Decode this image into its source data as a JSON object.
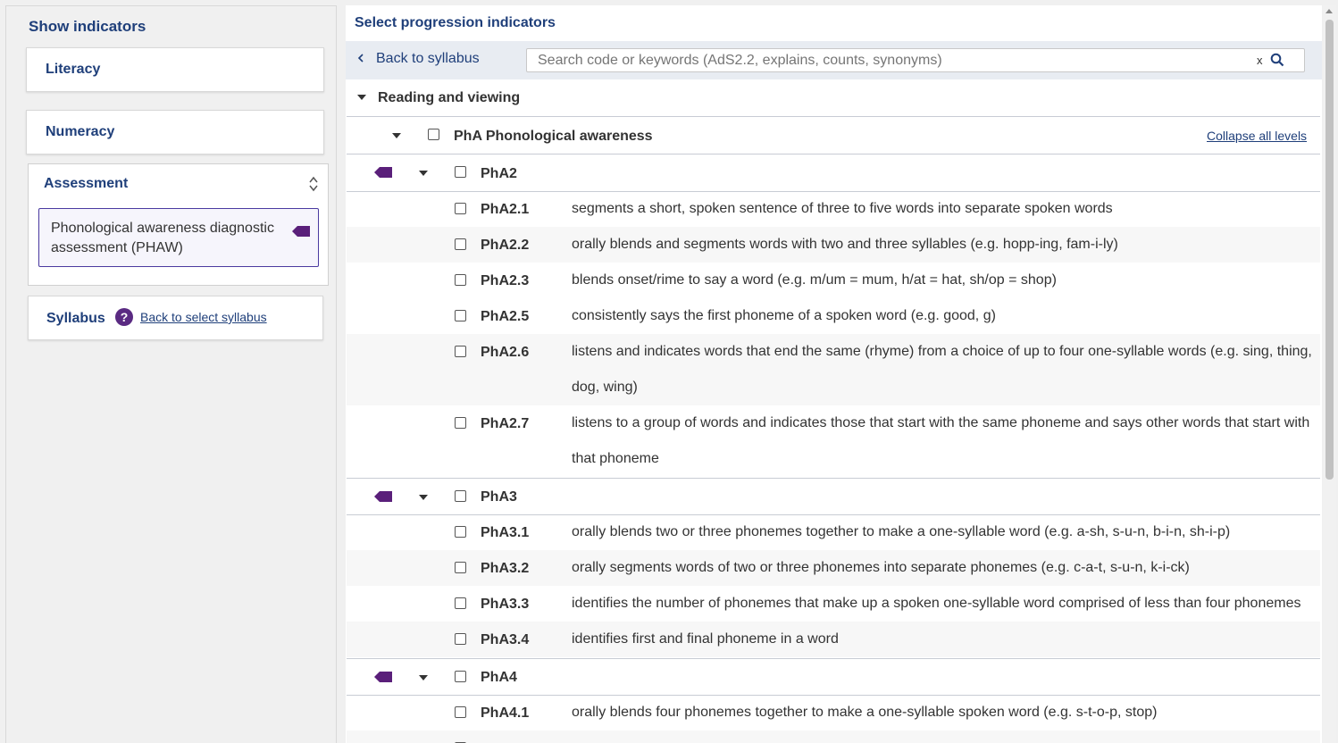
{
  "left": {
    "title": "Show indicators",
    "literacy": "Literacy",
    "numeracy": "Numeracy",
    "assessment": "Assessment",
    "assessment_item": "Phonological awareness diagnostic assessment (PHAW)",
    "syllabus": "Syllabus",
    "help": "?",
    "back_to_select_syllabus": "Back to select syllabus"
  },
  "right": {
    "title": "Select progression indicators",
    "back_to_syllabus": "Back to syllabus",
    "search_placeholder": "Search code or keywords (AdS2.2, explains, counts, synonyms)",
    "search_clear": "x",
    "reading_viewing": "Reading and viewing",
    "pha_label": "PhA Phonological awareness",
    "collapse_all": "Collapse all levels"
  },
  "groups": {
    "pha2": "PhA2",
    "pha3": "PhA3",
    "pha4": "PhA4"
  },
  "indicators": [
    {
      "code": "PhA2.1",
      "text": "segments a short, spoken sentence of three to five words into separate spoken words"
    },
    {
      "code": "PhA2.2",
      "text": "orally blends and segments words with two and three syllables (e.g. hopp-ing, fam-i-ly)"
    },
    {
      "code": "PhA2.3",
      "text": "blends onset/rime to say a word (e.g. m/um = mum, h/at = hat, sh/op = shop)"
    },
    {
      "code": "PhA2.5",
      "text": "consistently says the first phoneme of a spoken word (e.g. good, g)"
    },
    {
      "code": "PhA2.6",
      "text": "listens and indicates words that end the same (rhyme) from a choice of up to four one-syllable words (e.g. sing, thing, dog, wing)"
    },
    {
      "code": "PhA2.7",
      "text": "listens to a group of words and indicates those that start with the same phoneme and says other words that start with that phoneme"
    },
    {
      "code": "PhA3.1",
      "text": "orally blends two or three phonemes together to make a one-syllable word (e.g. a-sh, s-u-n, b-i-n, sh-i-p)"
    },
    {
      "code": "PhA3.2",
      "text": "orally segments words of two or three phonemes into separate phonemes (e.g. c-a-t, s-u-n, k-i-ck)"
    },
    {
      "code": "PhA3.3",
      "text": "identifies the number of phonemes that make up a spoken one-syllable word comprised of less than four phonemes"
    },
    {
      "code": "PhA3.4",
      "text": "identifies first and final phoneme in a word"
    },
    {
      "code": "PhA4.1",
      "text": "orally blends four phonemes together to make a one-syllable spoken word (e.g. s-t-o-p, stop)"
    }
  ],
  "colors": {
    "heading": "#1f3f7a",
    "tag": "#5a1f7a",
    "accent_border": "#4a3aa0"
  }
}
